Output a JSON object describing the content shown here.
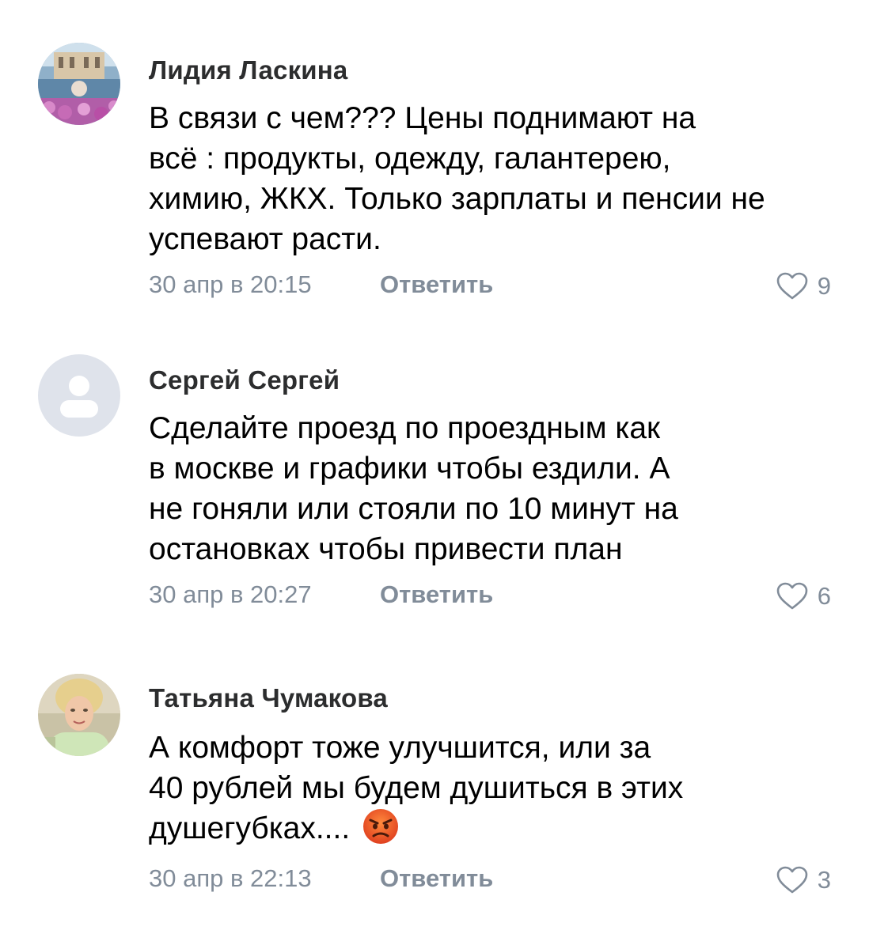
{
  "comments": [
    {
      "author": "Лидия Ласкина",
      "avatar": "photo-avatar",
      "text_lines": [
        "В связи с чем??? Цены поднимают на",
        "всё : продукты,  одежду, галантерею,",
        "химию, ЖКХ. Только зарплаты и пенсии не",
        "успевают расти."
      ],
      "date": "30 апр в 20:15",
      "reply_label": "Ответить",
      "likes": "9"
    },
    {
      "author": "Сергей Сергей",
      "avatar": "default-user-avatar",
      "text_lines": [
        "Сделайте проезд по проездным как",
        "в москве и графики чтобы ездили. А",
        "не гоняли или стояли по 10 минут на",
        "остановках чтобы привести план"
      ],
      "date": "30 апр в 20:27",
      "reply_label": "Ответить",
      "likes": "6"
    },
    {
      "author": "Татьяна Чумакова",
      "avatar": "photo-avatar",
      "text_lines": [
        "А  комфорт тоже улучшится, или за",
        "40 рублей мы будем душиться в этих",
        "душегубках...."
      ],
      "emoji": "angry-face-emoji",
      "date": "30 апр в 22:13",
      "reply_label": "Ответить",
      "likes": "3"
    }
  ],
  "colors": {
    "secondary_text": "#818c99",
    "author_text": "#2c2d2e",
    "body_text": "#000000",
    "background": "#ffffff"
  },
  "icons": {
    "like": "heart-outline-icon",
    "default_avatar": "user-silhouette-icon",
    "emoji": "angry-face-emoji"
  }
}
